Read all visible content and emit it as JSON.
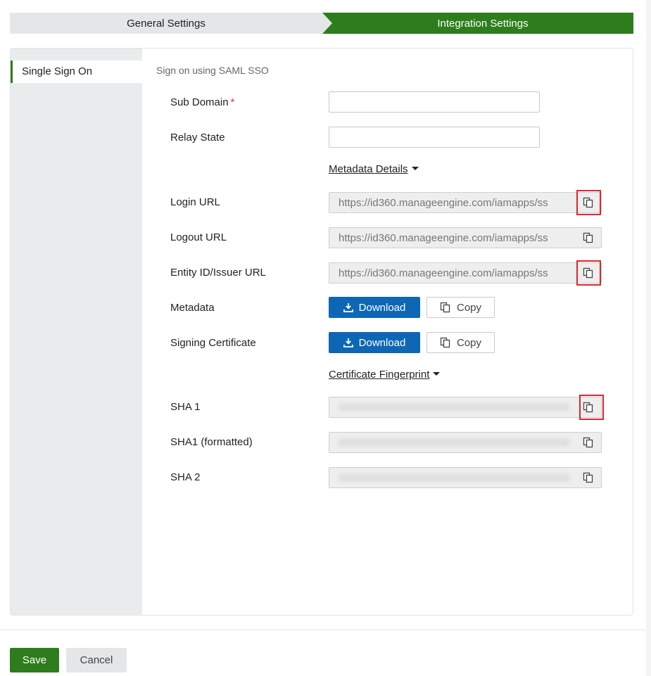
{
  "wizard": {
    "steps": [
      {
        "label": "General Settings",
        "active": false
      },
      {
        "label": "Integration Settings",
        "active": true
      }
    ]
  },
  "sidebar": {
    "items": [
      {
        "label": "Single Sign On",
        "selected": true
      }
    ]
  },
  "section_title": "Sign on using SAML SSO",
  "fields": {
    "sub_domain": {
      "label": "Sub Domain",
      "required_mark": "*",
      "value": ""
    },
    "relay_state": {
      "label": "Relay State",
      "value": ""
    }
  },
  "metadata_toggle": "Metadata Details",
  "urls": [
    {
      "label": "Login URL",
      "value": "https://id360.manageengine.com/iamapps/ss"
    },
    {
      "label": "Logout URL",
      "value": "https://id360.manageengine.com/iamapps/ss"
    },
    {
      "label": "Entity ID/Issuer URL",
      "value": "https://id360.manageengine.com/iamapps/ss"
    }
  ],
  "downloads": [
    {
      "label": "Metadata",
      "download_label": "Download",
      "copy_label": "Copy"
    },
    {
      "label": "Signing Certificate",
      "download_label": "Download",
      "copy_label": "Copy"
    }
  ],
  "fingerprint_toggle": "Certificate Fingerprint",
  "fingerprints": [
    {
      "label": "SHA 1"
    },
    {
      "label": "SHA1 (formatted)"
    },
    {
      "label": "SHA 2"
    }
  ],
  "footer": {
    "save_label": "Save",
    "cancel_label": "Cancel"
  },
  "colors": {
    "brand_green": "#2d7d1c",
    "download_blue": "#0d67b5",
    "highlight_red": "#e0262b"
  },
  "icons": {
    "copy": "copy-icon",
    "download": "download-icon",
    "caret": "caret-down-icon"
  }
}
